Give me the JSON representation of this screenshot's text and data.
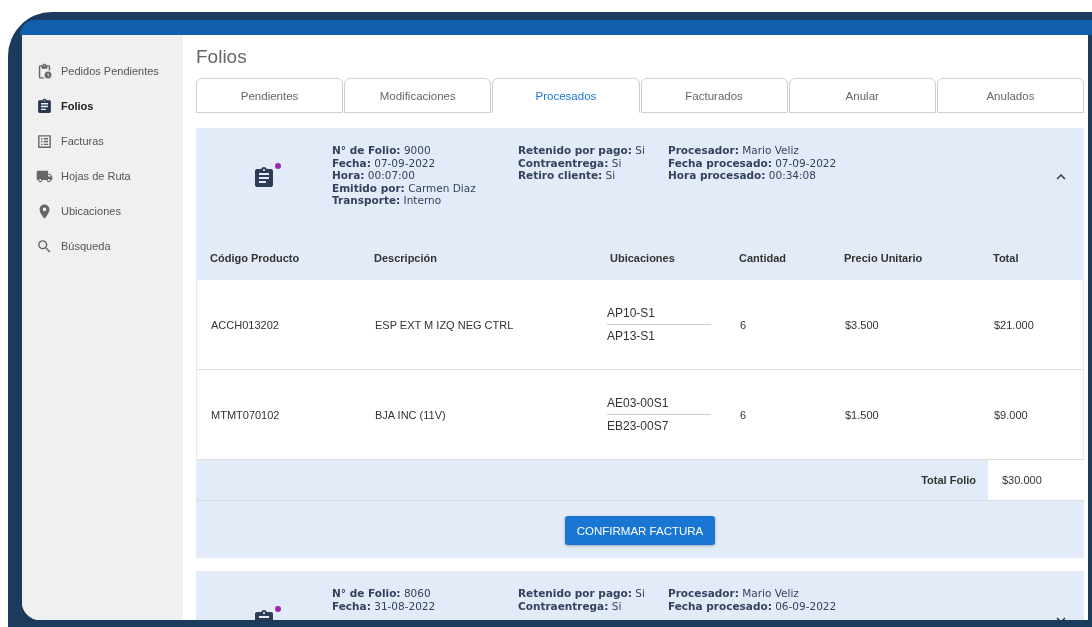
{
  "sidebar": {
    "items": [
      {
        "label": "Pedidos Pendientes",
        "selected": false
      },
      {
        "label": "Folios",
        "selected": true
      },
      {
        "label": "Facturas",
        "selected": false
      },
      {
        "label": "Hojas de Ruta",
        "selected": false
      },
      {
        "label": "Ubicaciones",
        "selected": false
      },
      {
        "label": "Búsqueda",
        "selected": false
      }
    ]
  },
  "page_title": "Folios",
  "tabs": [
    {
      "label": "Pendientes",
      "selected": false
    },
    {
      "label": "Modificaciones",
      "selected": false
    },
    {
      "label": "Procesados",
      "selected": true
    },
    {
      "label": "Facturados",
      "selected": false
    },
    {
      "label": "Anular",
      "selected": false
    },
    {
      "label": "Anulados",
      "selected": false
    }
  ],
  "folios": [
    {
      "expanded": true,
      "new": true,
      "info_columns": [
        [
          "**N° de Folio:** 9000",
          "**Fecha:** 07-09-2022",
          "**Hora:** 00:07:00",
          "**Emitido por:** Carmen Diaz",
          "**Transporte:** Interno"
        ],
        [
          "**Retenido por pago:** Si",
          "**Contraentrega:** Si",
          "**Retiro cliente:** Si"
        ],
        [
          "**Procesador:** Mario Veliz",
          "**Fecha procesado:** 07-09-2022",
          "**Hora procesado:** 00:34:08"
        ]
      ],
      "table": {
        "columns": [
          "Código Producto",
          "Descripción",
          "Ubicaciones",
          "Cantidad",
          "Precio Unitario",
          "Total"
        ],
        "rows": [
          {
            "code": "ACCH013202",
            "description": "ESP EXT M IZQ NEG CTRL",
            "locations": [
              "AP10-S1",
              "AP13-S1"
            ],
            "quantity": "6",
            "unit_price": "$3.500",
            "total": "$21.000"
          },
          {
            "code": "MTMT070102",
            "description": "BJA INC (11V)",
            "locations": [
              "AE03-00S1",
              "EB23-00S7"
            ],
            "quantity": "6",
            "unit_price": "$1.500",
            "total": "$9.000"
          }
        ],
        "total_label": "Total Folio",
        "total_value": "$30.000"
      },
      "button": "CONFIRMAR FACTURA"
    },
    {
      "expanded": false,
      "new": true,
      "info_columns": [
        [
          "**N° de Folio:** 8060",
          "**Fecha:** 31-08-2022"
        ],
        [
          "**Retenido por pago:** Si",
          "**Contraentrega:** Si"
        ],
        [
          "**Procesador:** Mario Veliz",
          "**Fecha procesado:** 06-09-2022"
        ]
      ]
    }
  ]
}
